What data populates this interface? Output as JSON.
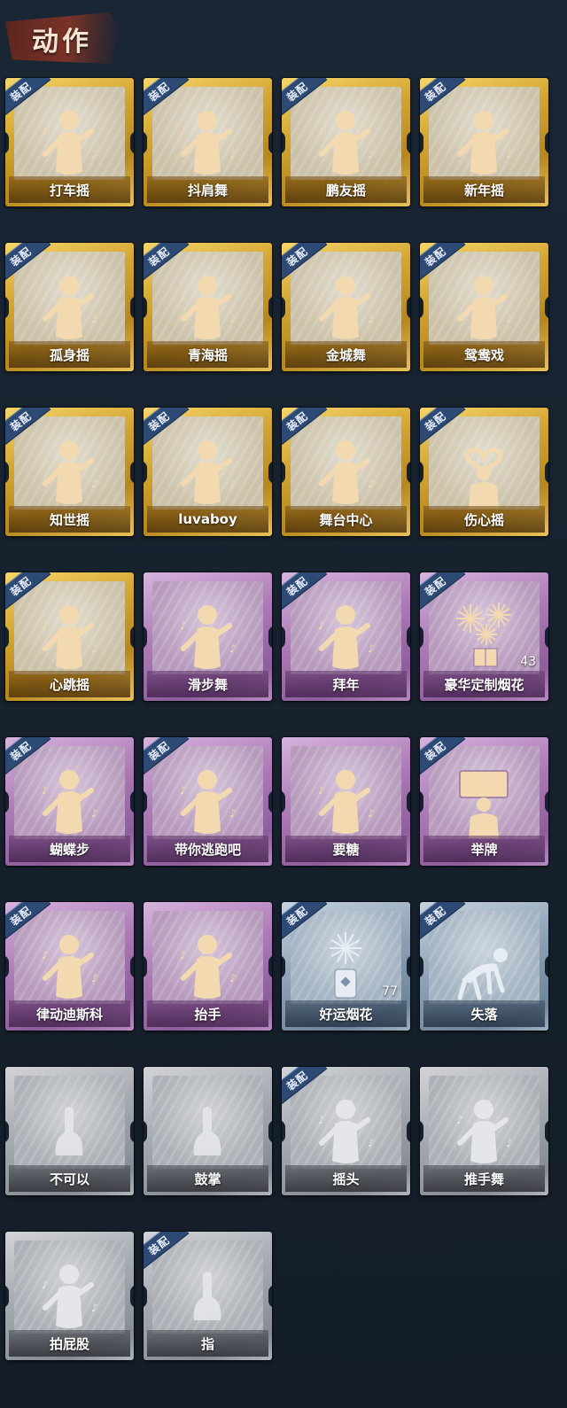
{
  "header": {
    "title": "动作"
  },
  "equip_label": "装配",
  "cards": [
    {
      "name": "打车摇",
      "rarity": "gold",
      "equipped": true,
      "icon": "dance-pose-icon"
    },
    {
      "name": "抖肩舞",
      "rarity": "gold",
      "equipped": true,
      "icon": "dance-pose-icon"
    },
    {
      "name": "鹏友摇",
      "rarity": "gold",
      "equipped": true,
      "icon": "dance-pose-icon"
    },
    {
      "name": "新年摇",
      "rarity": "gold",
      "equipped": true,
      "icon": "dance-pose-icon"
    },
    {
      "name": "孤身摇",
      "rarity": "gold",
      "equipped": true,
      "icon": "dance-pose-icon"
    },
    {
      "name": "青海摇",
      "rarity": "gold",
      "equipped": true,
      "icon": "dance-pose-icon"
    },
    {
      "name": "金城舞",
      "rarity": "gold",
      "equipped": true,
      "icon": "dance-pose-icon"
    },
    {
      "name": "鸳鸯戏",
      "rarity": "gold",
      "equipped": true,
      "icon": "dance-pose-icon"
    },
    {
      "name": "知世摇",
      "rarity": "gold",
      "equipped": true,
      "icon": "dance-pose-icon"
    },
    {
      "name": "luvaboy",
      "rarity": "gold",
      "equipped": true,
      "icon": "dance-pose-icon"
    },
    {
      "name": "舞台中心",
      "rarity": "gold",
      "equipped": true,
      "icon": "dance-pose-icon"
    },
    {
      "name": "伤心摇",
      "rarity": "gold",
      "equipped": true,
      "icon": "heart-hands-icon"
    },
    {
      "name": "心跳摇",
      "rarity": "gold",
      "equipped": true,
      "icon": "dance-pose-icon"
    },
    {
      "name": "滑步舞",
      "rarity": "purple",
      "equipped": false,
      "icon": "dance-pose-icon"
    },
    {
      "name": "拜年",
      "rarity": "purple",
      "equipped": true,
      "icon": "bow-pose-icon"
    },
    {
      "name": "豪华定制烟花",
      "rarity": "purple",
      "equipped": true,
      "icon": "fireworks-box-icon",
      "count": "43"
    },
    {
      "name": "蝴蝶步",
      "rarity": "purple",
      "equipped": true,
      "icon": "dance-pose-icon"
    },
    {
      "name": "带你逃跑吧",
      "rarity": "purple",
      "equipped": true,
      "icon": "dance-pose-icon"
    },
    {
      "name": "要糖",
      "rarity": "purple",
      "equipped": false,
      "icon": "reach-pose-icon"
    },
    {
      "name": "举牌",
      "rarity": "purple",
      "equipped": true,
      "icon": "sign-hold-icon"
    },
    {
      "name": "律动迪斯科",
      "rarity": "purple",
      "equipped": true,
      "icon": "dance-pose-icon"
    },
    {
      "name": "抬手",
      "rarity": "purple",
      "equipped": false,
      "icon": "reach-pose-icon"
    },
    {
      "name": "好运烟花",
      "rarity": "blue",
      "equipped": true,
      "icon": "firework-cylinder-icon",
      "count": "77"
    },
    {
      "name": "失落",
      "rarity": "blue",
      "equipped": true,
      "icon": "crawl-pose-icon"
    },
    {
      "name": "不可以",
      "rarity": "gray",
      "equipped": false,
      "icon": "finger-wag-icon"
    },
    {
      "name": "鼓掌",
      "rarity": "gray",
      "equipped": false,
      "icon": "clap-hands-icon"
    },
    {
      "name": "摇头",
      "rarity": "gray",
      "equipped": true,
      "icon": "shake-head-icon"
    },
    {
      "name": "推手舞",
      "rarity": "gray",
      "equipped": false,
      "icon": "push-hands-icon"
    },
    {
      "name": "拍屁股",
      "rarity": "gray",
      "equipped": false,
      "icon": "pat-pose-icon"
    },
    {
      "name": "指",
      "rarity": "gray",
      "equipped": true,
      "icon": "point-hand-icon"
    }
  ],
  "colors": {
    "gold": "#d4a734",
    "purple": "#ab79b6",
    "blue": "#8ea2b6",
    "gray": "#a4a8af",
    "badge": "#2d4a74",
    "background": "#16202c"
  }
}
